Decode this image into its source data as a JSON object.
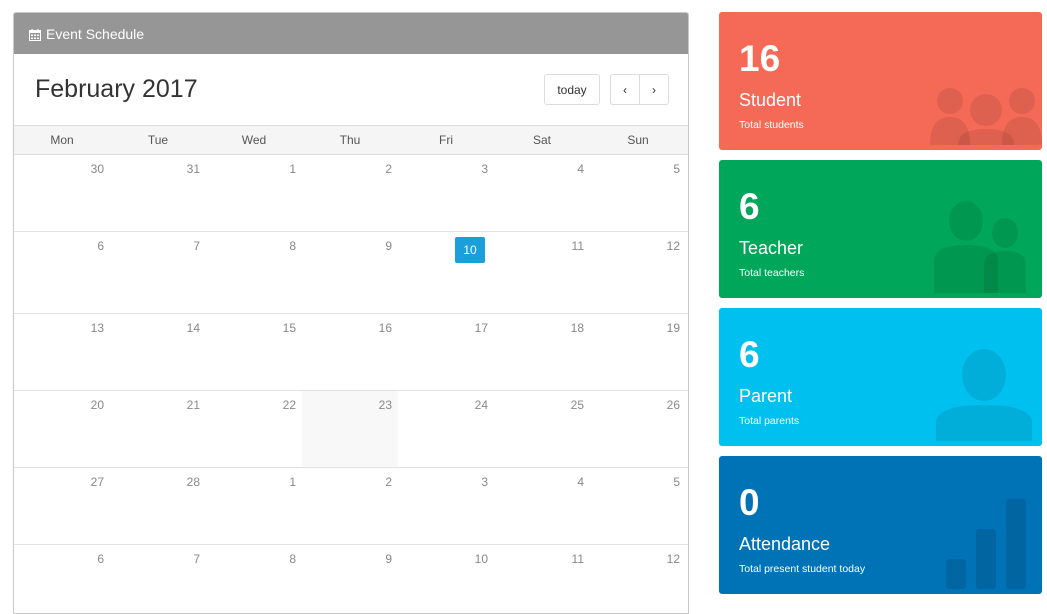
{
  "calendar": {
    "header_title": "Event Schedule",
    "month_title": "February 2017",
    "today_label": "today",
    "prev_label": "‹",
    "next_label": "›",
    "days_of_week": [
      "Mon",
      "Tue",
      "Wed",
      "Thu",
      "Fri",
      "Sat",
      "Sun"
    ],
    "weeks": [
      [
        "30",
        "31",
        "1",
        "2",
        "3",
        "4",
        "5"
      ],
      [
        "6",
        "7",
        "8",
        "9",
        "10",
        "11",
        "12"
      ],
      [
        "13",
        "14",
        "15",
        "16",
        "17",
        "18",
        "19"
      ],
      [
        "20",
        "21",
        "22",
        "23",
        "24",
        "25",
        "26"
      ],
      [
        "27",
        "28",
        "1",
        "2",
        "3",
        "4",
        "5"
      ],
      [
        "6",
        "7",
        "8",
        "9",
        "10",
        "11",
        "12"
      ]
    ],
    "highlight_color": "#1a9fdb"
  },
  "cards": [
    {
      "count": "16",
      "label": "Student",
      "sub": "Total students",
      "color": "#f56a57",
      "icon": "users-icon"
    },
    {
      "count": "6",
      "label": "Teacher",
      "sub": "Total teachers",
      "color": "#00a65a",
      "icon": "teachers-icon"
    },
    {
      "count": "6",
      "label": "Parent",
      "sub": "Total parents",
      "color": "#00c0ef",
      "icon": "user-icon"
    },
    {
      "count": "0",
      "label": "Attendance",
      "sub": "Total present student today",
      "color": "#0073b7",
      "icon": "bar-chart-icon"
    }
  ]
}
